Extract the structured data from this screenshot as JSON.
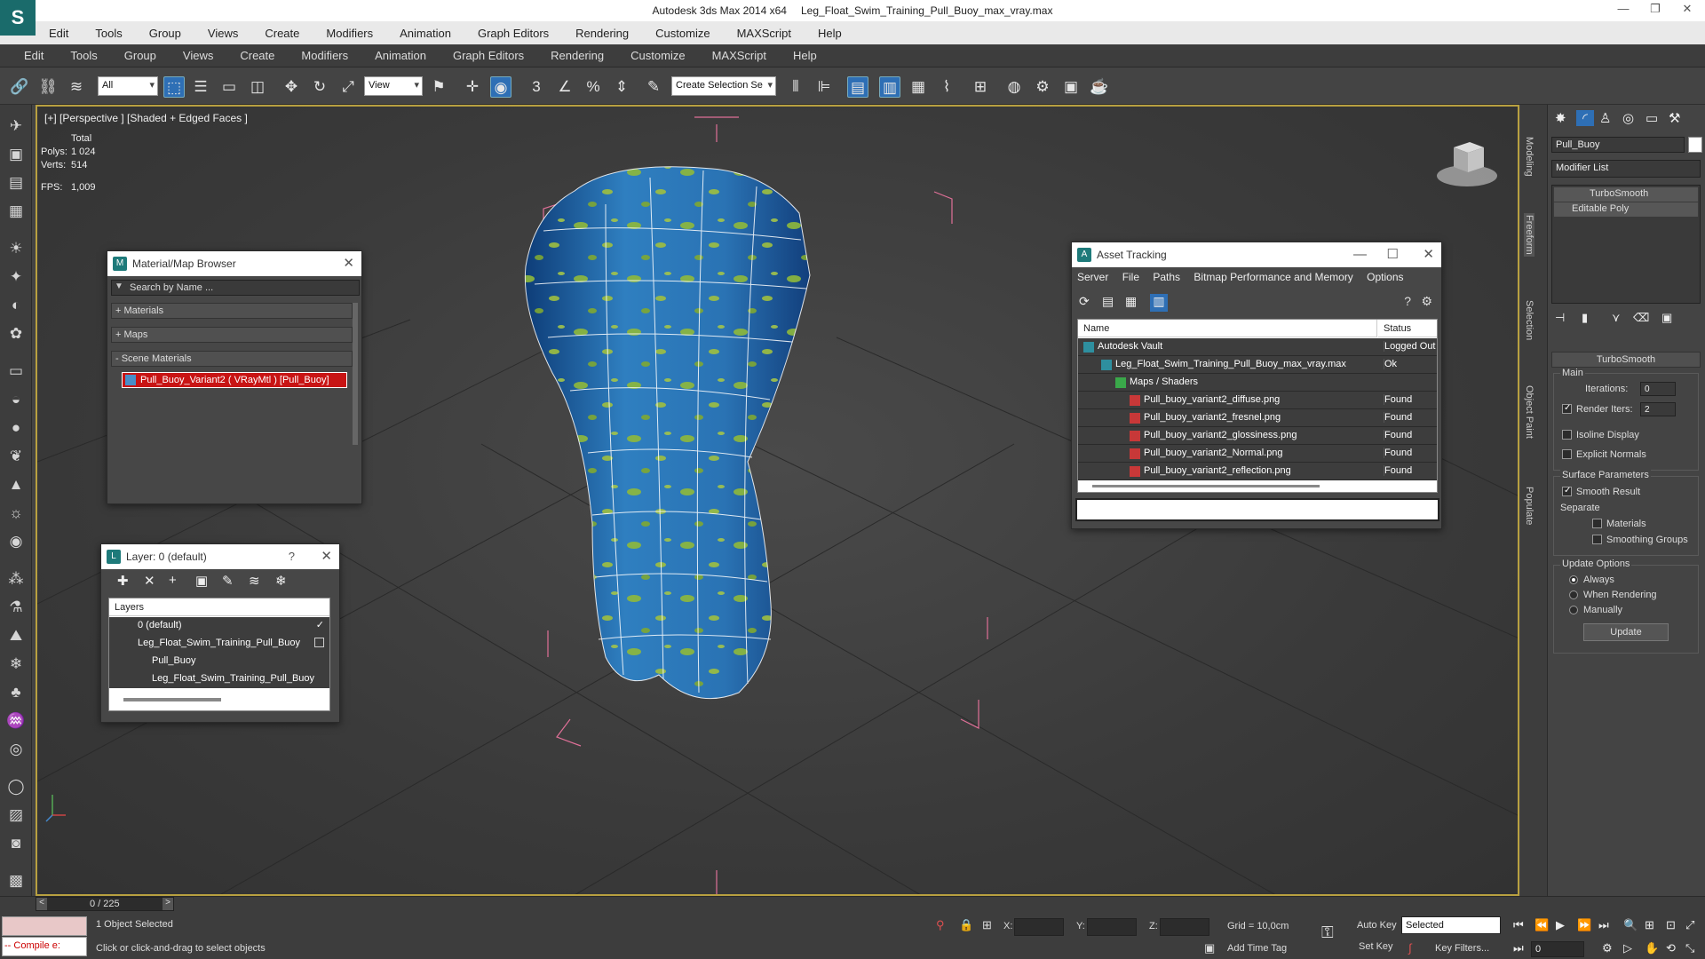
{
  "titlebar": {
    "app": "Autodesk 3ds Max  2014 x64",
    "file": "Leg_Float_Swim_Training_Pull_Buoy_max_vray.max"
  },
  "menu_primary": [
    "Edit",
    "Tools",
    "Group",
    "Views",
    "Create",
    "Modifiers",
    "Animation",
    "Graph Editors",
    "Rendering",
    "Customize",
    "MAXScript",
    "Help"
  ],
  "menu_secondary": [
    "Edit",
    "Tools",
    "Group",
    "Views",
    "Create",
    "Modifiers",
    "Animation",
    "Graph Editors",
    "Rendering",
    "Customize",
    "MAXScript",
    "Help"
  ],
  "toolbar": {
    "filter_value": "All",
    "refcoord_value": "View",
    "selection_set_placeholder": "Create Selection Se"
  },
  "viewport": {
    "label": "[+] [Perspective ] [Shaded + Edged Faces ]",
    "stats": {
      "total_label": "Total",
      "polys_label": "Polys:",
      "polys": "1 024",
      "verts_label": "Verts:",
      "verts": "514",
      "fps_label": "FPS:",
      "fps": "1,009"
    }
  },
  "material_browser": {
    "title": "Material/Map Browser",
    "search_placeholder": "Search by Name ...",
    "sections": [
      "+ Materials",
      "+ Maps",
      "- Scene Materials"
    ],
    "item": "Pull_Buoy_Variant2  ( VRayMtl )  [Pull_Buoy]"
  },
  "layer_dialog": {
    "title": "Layer: 0 (default)",
    "help": "?",
    "header": "Layers",
    "rows": [
      "0 (default)",
      "Leg_Float_Swim_Training_Pull_Buoy",
      "Pull_Buoy",
      "Leg_Float_Swim_Training_Pull_Buoy"
    ]
  },
  "asset_tracking": {
    "title": "Asset Tracking",
    "menu": [
      "Server",
      "File",
      "Paths",
      "Bitmap Performance and Memory",
      "Options"
    ],
    "col_name": "Name",
    "col_status": "Status",
    "rows": [
      {
        "name": "Autodesk Vault",
        "status": "Logged Out"
      },
      {
        "name": "Leg_Float_Swim_Training_Pull_Buoy_max_vray.max",
        "status": "Ok"
      },
      {
        "name": "Maps / Shaders",
        "status": ""
      },
      {
        "name": "Pull_buoy_variant2_diffuse.png",
        "status": "Found"
      },
      {
        "name": "Pull_buoy_variant2_fresnel.png",
        "status": "Found"
      },
      {
        "name": "Pull_buoy_variant2_glossiness.png",
        "status": "Found"
      },
      {
        "name": "Pull_buoy_variant2_Normal.png",
        "status": "Found"
      },
      {
        "name": "Pull_buoy_variant2_reflection.png",
        "status": "Found"
      }
    ]
  },
  "side_tabs": [
    "Modeling",
    "Freeform",
    "Selection",
    "Object Paint",
    "Populate"
  ],
  "command_panel": {
    "object_name": "Pull_Buoy",
    "modifier_list": "Modifier List",
    "stack": [
      "TurboSmooth",
      "Editable Poly"
    ],
    "rollout": "TurboSmooth",
    "main": "Main",
    "iterations_label": "Iterations:",
    "iterations": "0",
    "render_iters_label": "Render Iters:",
    "render_iters": "2",
    "isoline": "Isoline Display",
    "explicit_normals": "Explicit Normals",
    "surface_params": "Surface Parameters",
    "smooth_result": "Smooth Result",
    "separate": "Separate",
    "materials": "Materials",
    "smoothing_groups": "Smoothing Groups",
    "update_options": "Update Options",
    "always": "Always",
    "when_rendering": "When Rendering",
    "manually": "Manually",
    "update_btn": "Update"
  },
  "status": {
    "frame": "0 / 225",
    "maxscript": "-- Compile e:",
    "selected": "1 Object Selected",
    "prompt": "Click or click-and-drag to select objects",
    "x_label": "X:",
    "y_label": "Y:",
    "z_label": "Z:",
    "grid": "Grid = 10,0cm",
    "add_time_tag": "Add Time Tag",
    "auto_key": "Auto Key",
    "set_key": "Set Key",
    "key_mode": "Selected",
    "key_filters": "Key Filters...",
    "frame_field": "0"
  }
}
